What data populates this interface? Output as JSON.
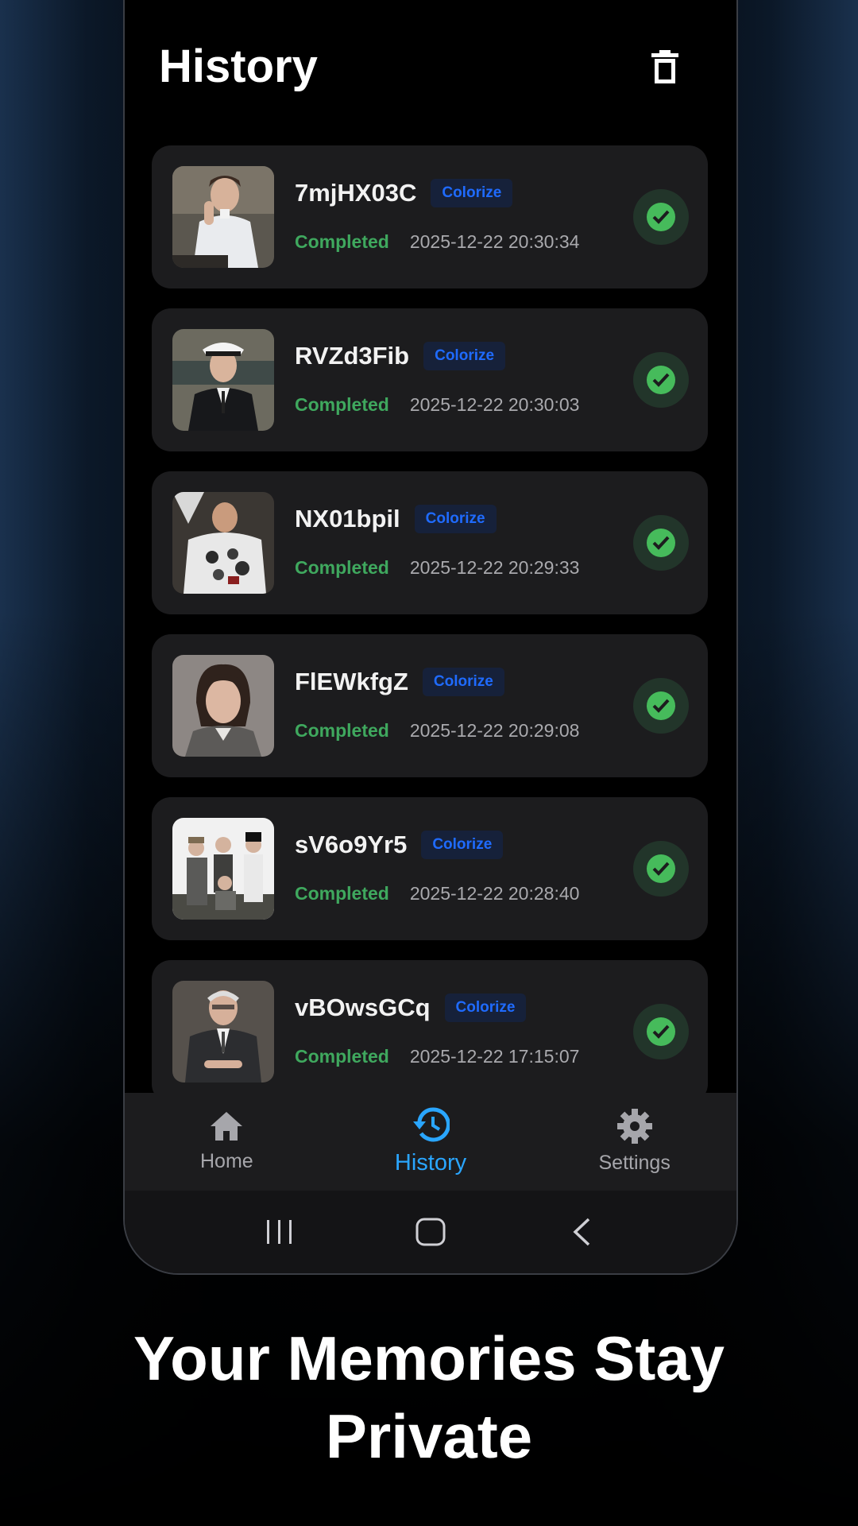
{
  "header": {
    "title": "History",
    "delete_icon": "trash-icon"
  },
  "history": {
    "items": [
      {
        "name": "7mjHX03C",
        "badge": "Colorize",
        "status": "Completed",
        "timestamp": "2025-12-22 20:30:34"
      },
      {
        "name": "RVZd3Fib",
        "badge": "Colorize",
        "status": "Completed",
        "timestamp": "2025-12-22 20:30:03"
      },
      {
        "name": "NX01bpil",
        "badge": "Colorize",
        "status": "Completed",
        "timestamp": "2025-12-22 20:29:33"
      },
      {
        "name": "FlEWkfgZ",
        "badge": "Colorize",
        "status": "Completed",
        "timestamp": "2025-12-22 20:29:08"
      },
      {
        "name": "sV6o9Yr5",
        "badge": "Colorize",
        "status": "Completed",
        "timestamp": "2025-12-22 20:28:40"
      },
      {
        "name": "vBOwsGCq",
        "badge": "Colorize",
        "status": "Completed",
        "timestamp": "2025-12-22 17:15:07"
      }
    ]
  },
  "nav": {
    "items": [
      {
        "label": "Home",
        "icon": "home-icon"
      },
      {
        "label": "History",
        "icon": "history-icon",
        "active": true
      },
      {
        "label": "Settings",
        "icon": "gear-icon"
      }
    ]
  },
  "tagline": {
    "line1": "Your Memories Stay",
    "line2": "Private"
  },
  "colors": {
    "accent": "#2aa6ff",
    "status_green": "#3fa85e",
    "badge_blue": "#1f6bff",
    "card_bg": "#1c1c1e"
  }
}
